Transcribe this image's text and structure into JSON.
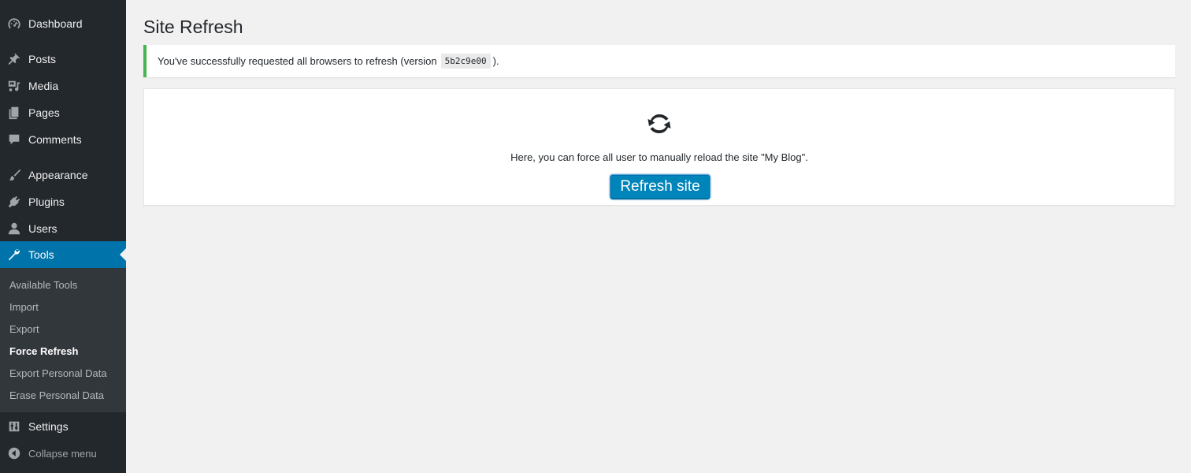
{
  "colors": {
    "sidebar_bg": "#23282d",
    "submenu_bg": "#32373c",
    "accent": "#0073aa",
    "button": "#0085ba",
    "notice_border": "#46b450",
    "page_bg": "#f1f1f1"
  },
  "sidebar": {
    "items": [
      {
        "label": "Dashboard",
        "icon": "dashboard-icon"
      },
      {
        "label": "Posts",
        "icon": "pushpin-icon"
      },
      {
        "label": "Media",
        "icon": "media-icon"
      },
      {
        "label": "Pages",
        "icon": "pages-icon"
      },
      {
        "label": "Comments",
        "icon": "comment-icon"
      },
      {
        "label": "Appearance",
        "icon": "paintbrush-icon"
      },
      {
        "label": "Plugins",
        "icon": "plug-icon"
      },
      {
        "label": "Users",
        "icon": "user-icon"
      },
      {
        "label": "Tools",
        "icon": "wrench-icon",
        "active": true
      },
      {
        "label": "Settings",
        "icon": "settings-sliders-icon"
      }
    ],
    "submenu": [
      {
        "label": "Available Tools"
      },
      {
        "label": "Import"
      },
      {
        "label": "Export"
      },
      {
        "label": "Force Refresh",
        "current": true
      },
      {
        "label": "Export Personal Data"
      },
      {
        "label": "Erase Personal Data"
      }
    ],
    "collapse_label": "Collapse menu",
    "collapse_icon": "collapse-arrow-icon"
  },
  "main": {
    "title": "Site Refresh",
    "notice": {
      "text_before": "You've successfully requested all browsers to refresh (version",
      "version": "5b2c9e00",
      "text_after": ")."
    },
    "panel": {
      "icon": "refresh-icon",
      "description": "Here, you can force all user to manually reload the site \"My Blog\".",
      "button_label": "Refresh site"
    }
  }
}
